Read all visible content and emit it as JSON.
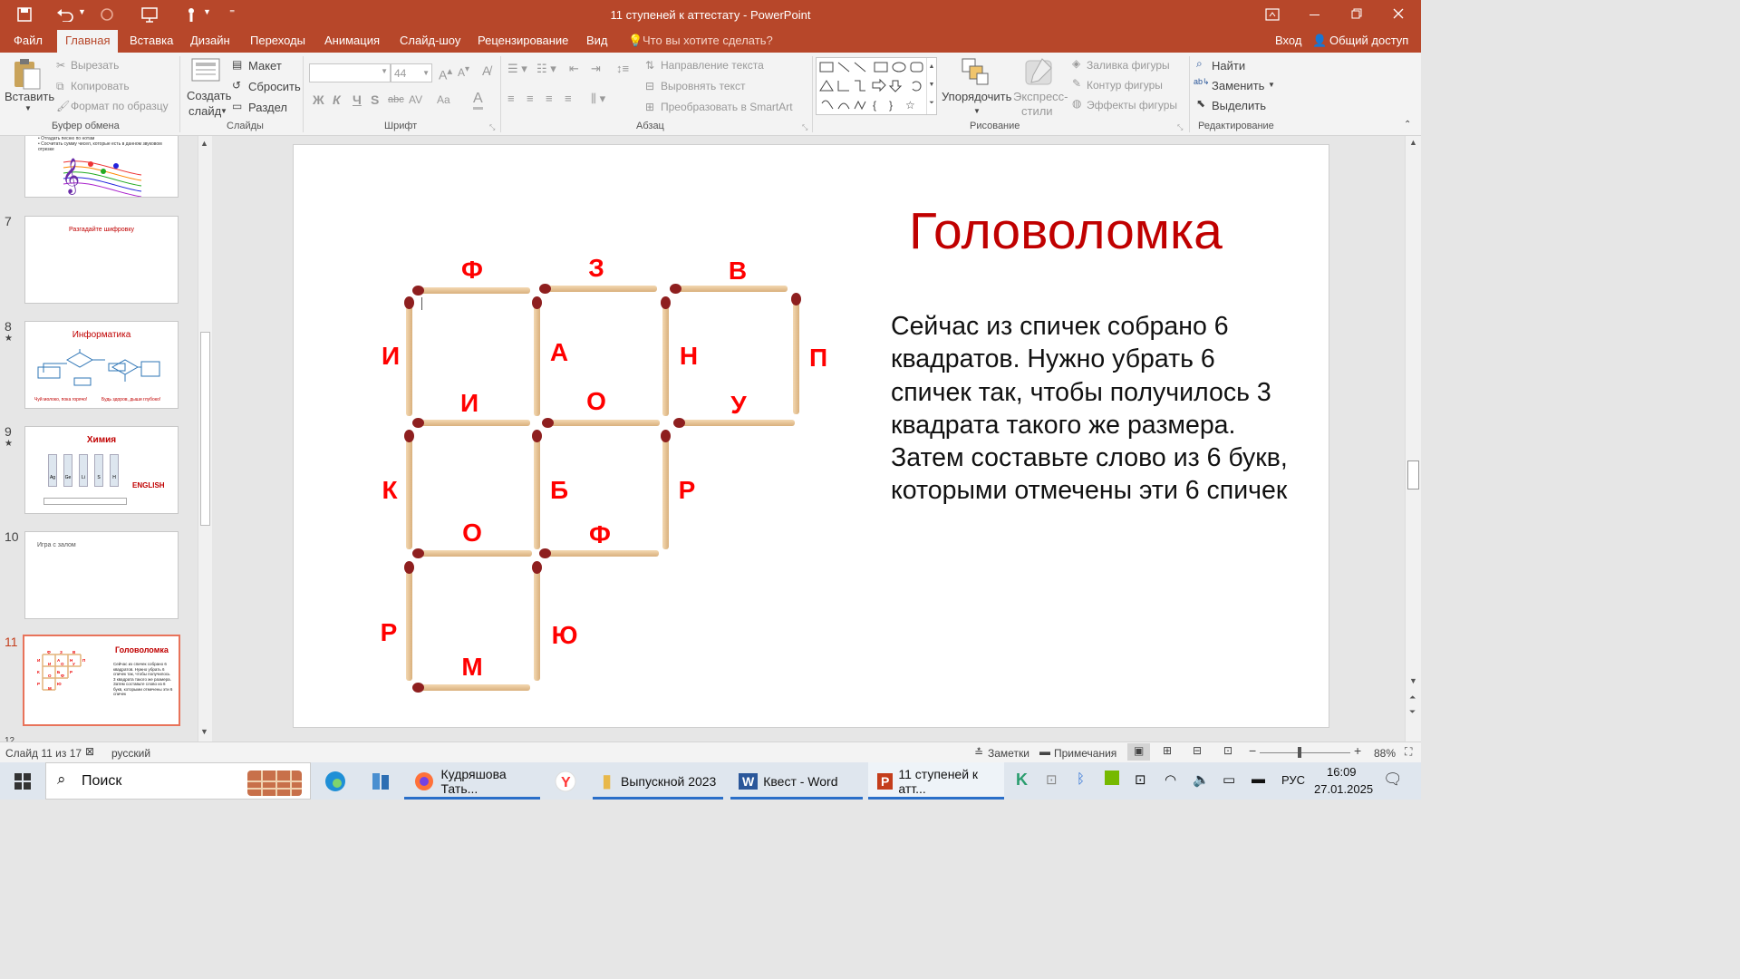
{
  "window": {
    "title": "11 ступеней к аттестату - PowerPoint"
  },
  "tabs": [
    "Файл",
    "Главная",
    "Вставка",
    "Дизайн",
    "Переходы",
    "Анимация",
    "Слайд-шоу",
    "Рецензирование",
    "Вид"
  ],
  "tell_me": "Что вы хотите сделать?",
  "signin": "Вход",
  "share": "Общий доступ",
  "ribbon": {
    "clipboard": {
      "paste": "Вставить",
      "cut": "Вырезать",
      "copy": "Копировать",
      "format_painter": "Формат по образцу",
      "label": "Буфер обмена"
    },
    "slides": {
      "new_line1": "Создать",
      "new_line2": "слайд",
      "layout": "Макет",
      "reset": "Сбросить",
      "section": "Раздел",
      "label": "Слайды"
    },
    "font": {
      "name": "",
      "size": "44",
      "label": "Шрифт",
      "bold": "Ж",
      "italic": "К",
      "underline": "Ч",
      "strike": "S",
      "shadow": "abc",
      "spacing": "AV",
      "case": "Aa",
      "color": "A"
    },
    "paragraph": {
      "direction": "Направление текста",
      "align": "Выровнять текст",
      "smartart": "Преобразовать в SmartArt",
      "label": "Абзац"
    },
    "drawing": {
      "arrange": "Упорядочить",
      "styles_line1": "Экспресс-",
      "styles_line2": "стили",
      "fill": "Заливка фигуры",
      "outline": "Контур фигуры",
      "effects": "Эффекты фигуры",
      "label": "Рисование"
    },
    "editing": {
      "find": "Найти",
      "replace": "Заменить",
      "select": "Выделить",
      "label": "Редактирование"
    }
  },
  "thumbs": [
    {
      "num": "",
      "lines": [
        "• Отгадать песню по нотам",
        "• Сосчитать сумму чисел, которые есть в данном звуковом отрезке"
      ]
    },
    {
      "num": "7",
      "title": "Разгадайте шифровку"
    },
    {
      "num": "8",
      "title": "Информатика",
      "footer_left": "Чуй молоко, пока горячо!",
      "footer_right": "Будь здоров, дыши глубоко!"
    },
    {
      "num": "9",
      "title": "Химия",
      "extra": "ENGLISH",
      "tubes": [
        "Ag",
        "Ge",
        "Li",
        "S",
        "H"
      ]
    },
    {
      "num": "10",
      "title": "Игра с залом"
    },
    {
      "num": "11",
      "title": "Головоломка",
      "text": "Сейчас из спичек собрано 6 квадратов. Нужно убрать 6 спичек так, чтобы получилось 3 квадрата такого же размера. Затем составьте слово из 6 букв, которыми отмечены эти 6 спичек"
    }
  ],
  "slide": {
    "title": "Головоломка",
    "body": "Сейчас из спичек собрано 6 квадратов. Нужно убрать 6 спичек так, чтобы получилось 3 квадрата такого же размера. Затем составьте слово из 6 букв, которыми отмечены эти 6 спичек",
    "letters": [
      "Ф",
      "З",
      "В",
      "И",
      "А",
      "Н",
      "П",
      "И",
      "О",
      "У",
      "К",
      "Б",
      "Р",
      "О",
      "Ф",
      "Р",
      "Ю",
      "М"
    ]
  },
  "status": {
    "slide": "Слайд 11 из 17",
    "lang": "русский",
    "notes": "Заметки",
    "comments": "Примечания",
    "zoom": "88%"
  },
  "taskbar": {
    "search": "Поиск",
    "apps": [
      "Кудряшова Тать...",
      "Выпускной 2023",
      "Квест - Word",
      "11 ступеней к атт..."
    ],
    "lang": "РУС",
    "time": "16:09",
    "date": "27.01.2025"
  },
  "colors": {
    "accent": "#b7472a",
    "title_red": "#c00000",
    "letter_red": "#ff0000"
  }
}
